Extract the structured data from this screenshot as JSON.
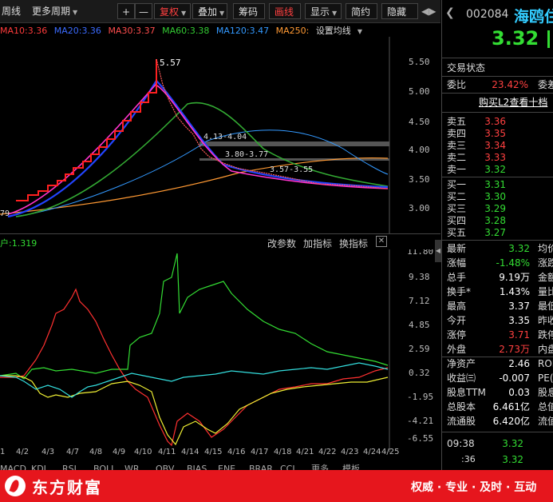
{
  "toolbar": {
    "period": "周线",
    "more_period": "更多周期",
    "plus": "+",
    "minus": "—",
    "adjust": "复权",
    "overlay": "叠加",
    "chips": "筹码",
    "draw": "画线",
    "show": "显示",
    "simple": "简约",
    "hide": "隐藏"
  },
  "ma": {
    "ma10": "MA10:3.36",
    "ma20": "MA20:3.36",
    "ma30": "MA30:3.37",
    "ma60": "MA60:3.38",
    "ma120": "MA120:3.47",
    "ma250": "MA250:",
    "settings": "设置均线"
  },
  "colors": {
    "ma10": "#ff3b3b",
    "ma20": "#3b6bff",
    "ma30": "#ff4d4d",
    "ma60": "#33cc33",
    "ma120": "#3399ff",
    "ma250": "#ff9933"
  },
  "main_chart": {
    "y_ticks": [
      "5.50",
      "5.00",
      "4.50",
      "4.00",
      "3.50",
      "3.00"
    ],
    "annotations": [
      "5.57",
      "4.13-4.04",
      "3.80-3.77",
      "3.57-3.55"
    ],
    "left_label": "79"
  },
  "indicator": {
    "label": "户:1.319",
    "buttons": [
      "改参数",
      "加指标",
      "换指标"
    ],
    "y_ticks": [
      "11.80",
      "9.38",
      "7.12",
      "4.85",
      "2.59",
      "0.32",
      "-1.95",
      "-4.21",
      "-6.55"
    ]
  },
  "x_axis": [
    "1",
    "4/2",
    "4/3",
    "4/7",
    "4/8",
    "4/9",
    "4/10",
    "4/11",
    "4/14",
    "4/15",
    "4/16",
    "4/17",
    "4/18",
    "4/21",
    "4/22",
    "4/23",
    "4/24",
    "4/25"
  ],
  "tabs": [
    "MACD",
    "KDJ",
    "RSI",
    "BOLL",
    "WR",
    "OBV",
    "BIAS",
    "ENE",
    "BRAR",
    "CCI",
    "更多",
    "模板"
  ],
  "stock": {
    "code": "002084",
    "name": "海鸥住",
    "price": "3.32"
  },
  "trade": {
    "status_label": "交易状态",
    "weibi_label": "委比",
    "weibi_val": "23.42%",
    "weicha_label": "委差",
    "l2_text": "购买L2查看十档"
  },
  "asks": [
    {
      "label": "卖五",
      "price": "3.36"
    },
    {
      "label": "卖四",
      "price": "3.35"
    },
    {
      "label": "卖三",
      "price": "3.34"
    },
    {
      "label": "卖二",
      "price": "3.33"
    },
    {
      "label": "卖一",
      "price": "3.32"
    }
  ],
  "bids": [
    {
      "label": "买一",
      "price": "3.31"
    },
    {
      "label": "买二",
      "price": "3.30"
    },
    {
      "label": "买三",
      "price": "3.29"
    },
    {
      "label": "买四",
      "price": "3.28"
    },
    {
      "label": "买五",
      "price": "3.27"
    }
  ],
  "quote": [
    {
      "label": "最新",
      "val": "3.32",
      "x": "均价",
      "cls": "green"
    },
    {
      "label": "涨幅",
      "val": "-1.48%",
      "x": "涨跌",
      "cls": "green"
    },
    {
      "label": "总手",
      "val": "9.19万",
      "x": "金额",
      "cls": "white"
    },
    {
      "label": "换手*",
      "val": "1.43%",
      "x": "量比",
      "cls": "white"
    },
    {
      "label": "最高",
      "val": "3.37",
      "x": "最低",
      "cls": "white"
    },
    {
      "label": "今开",
      "val": "3.35",
      "x": "昨收",
      "cls": "white"
    },
    {
      "label": "涨停",
      "val": "3.71",
      "x": "跌停",
      "cls": "red"
    },
    {
      "label": "外盘",
      "val": "2.73万",
      "x": "内盘",
      "cls": "red"
    },
    {
      "label": "净资产",
      "val": "2.46",
      "x": "ROE",
      "cls": "white"
    },
    {
      "label": "收益㈢",
      "val": "-0.007",
      "x": "PE(动",
      "cls": "white"
    },
    {
      "label": "股息TTM",
      "val": "0.03",
      "x": "股息",
      "cls": "white"
    },
    {
      "label": "总股本",
      "val": "6.461亿",
      "x": "总值",
      "cls": "white"
    },
    {
      "label": "流通股",
      "val": "6.420亿",
      "x": "流值",
      "cls": "white"
    }
  ],
  "ticks": [
    {
      "time": "09:38",
      "price": "3.32"
    },
    {
      "time": ":36",
      "price": "3.32"
    }
  ],
  "brand": {
    "name": "东方财富",
    "slogan": "权威 · 专业 · 及时 · 互动"
  }
}
